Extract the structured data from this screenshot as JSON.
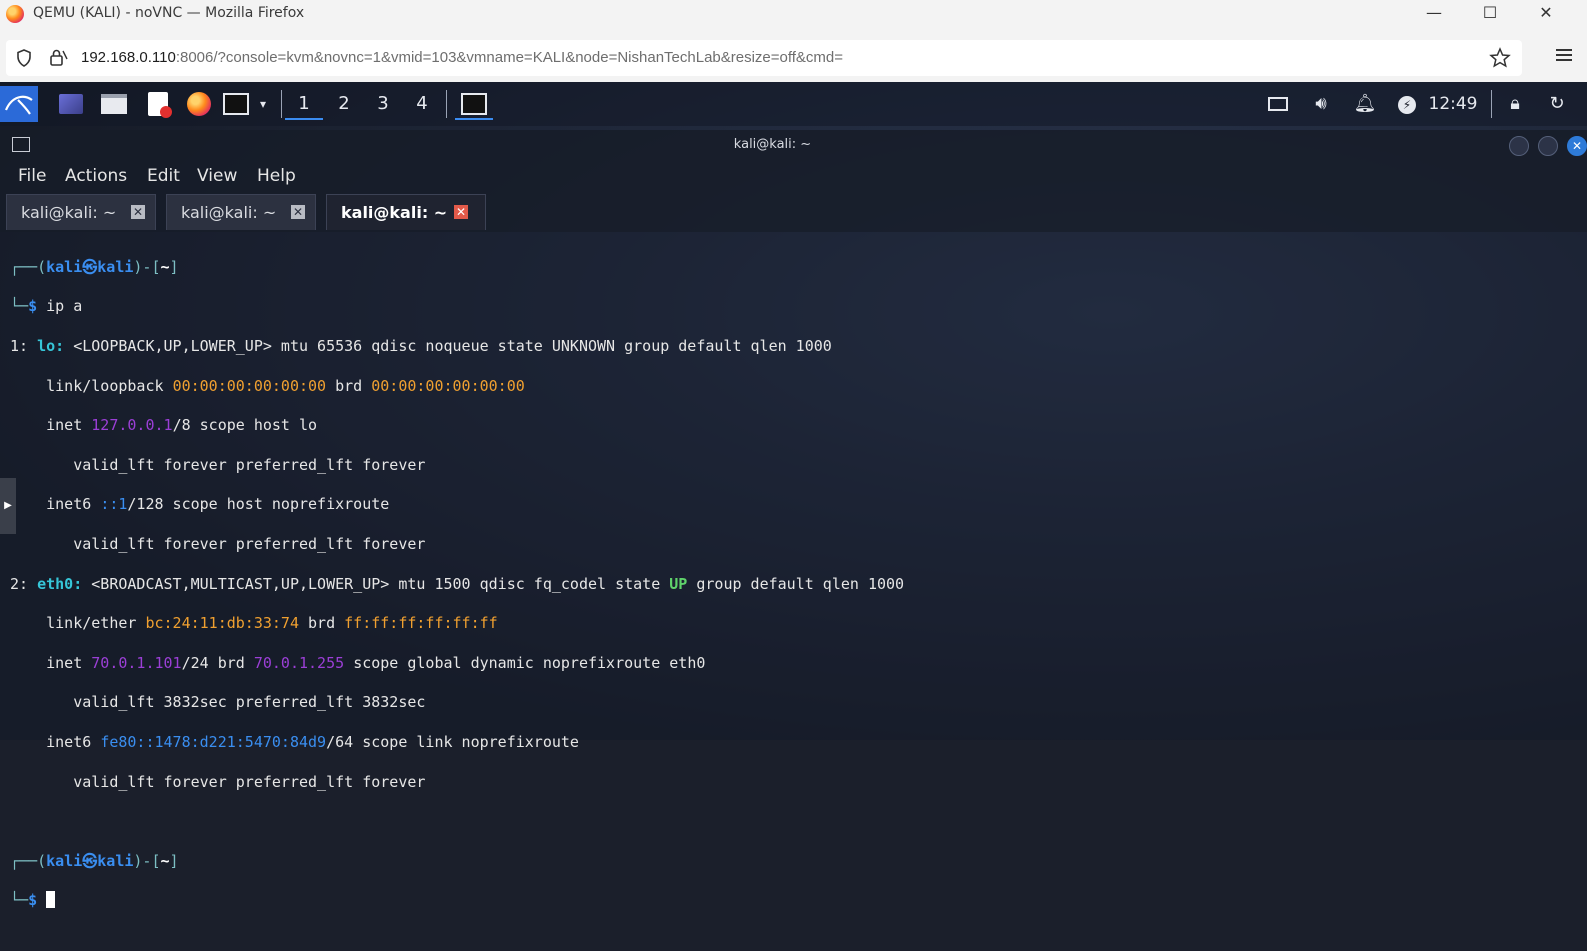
{
  "browser": {
    "window_title": "QEMU (KALI) - noVNC — Mozilla Firefox",
    "url_host": "192.168.0.110",
    "url_rest": ":8006/?console=kvm&novnc=1&vmid=103&vmname=KALI&node=NishanTechLab&resize=off&cmd=",
    "controls": {
      "minimize": "—",
      "maximize": "☐",
      "close": "✕"
    }
  },
  "panel": {
    "workspaces": [
      "1",
      "2",
      "3",
      "4"
    ],
    "active_workspace": "1",
    "clock": "12:49",
    "icons": [
      "kali-menu-icon",
      "desktop-icon",
      "file-manager-icon",
      "text-editor-icon",
      "firefox-icon",
      "terminal-icon",
      "chevron-down-icon",
      "terminal-window-icon",
      "display-icon",
      "volume-icon",
      "notification-icon",
      "power-icon",
      "lock-icon",
      "logout-icon"
    ]
  },
  "terminal": {
    "title": "kali@kali: ~",
    "menu": [
      "File",
      "Actions",
      "Edit",
      "View",
      "Help"
    ],
    "tabs": [
      {
        "label": "kali@kali: ~",
        "active": false
      },
      {
        "label": "kali@kali: ~",
        "active": false
      },
      {
        "label": "kali@kali: ~",
        "active": true
      }
    ],
    "user": "kali",
    "host": "kali",
    "cwd": "~",
    "command": "ip a",
    "output": {
      "lo_index": "1:",
      "lo_name": "lo:",
      "lo_flags": "<LOOPBACK,UP,LOWER_UP> mtu 65536 qdisc noqueue state UNKNOWN group default qlen 1000",
      "lo_link_type": "link/loopback",
      "lo_mac": "00:00:00:00:00:00",
      "lo_brd": "00:00:00:00:00:00",
      "lo_inet": "127.0.0.1",
      "lo_inet_suffix": "/8 scope host lo",
      "lo_valid1": "valid_lft forever preferred_lft forever",
      "lo_inet6": "::1",
      "lo_inet6_suffix": "/128 scope host noprefixroute",
      "lo_valid2": "valid_lft forever preferred_lft forever",
      "eth_index": "2:",
      "eth_name": "eth0:",
      "eth_flags": "<BROADCAST,MULTICAST,UP,LOWER_UP> mtu 1500 qdisc fq_codel state",
      "eth_state": "UP",
      "eth_flags_tail": "group default qlen 1000",
      "eth_link_type": "link/ether",
      "eth_mac": "bc:24:11:db:33:74",
      "eth_brd": "ff:ff:ff:ff:ff:ff",
      "eth_inet": "70.0.1.101",
      "eth_inet_mid": "/24 brd",
      "eth_inet_brd": "70.0.1.255",
      "eth_inet_suffix": "scope global dynamic noprefixroute eth0",
      "eth_valid1": "valid_lft 3832sec preferred_lft 3832sec",
      "eth_inet6": "fe80::1478:d221:5470:84d9",
      "eth_inet6_suffix": "/64 scope link noprefixroute",
      "eth_valid2": "valid_lft forever preferred_lft forever"
    }
  }
}
